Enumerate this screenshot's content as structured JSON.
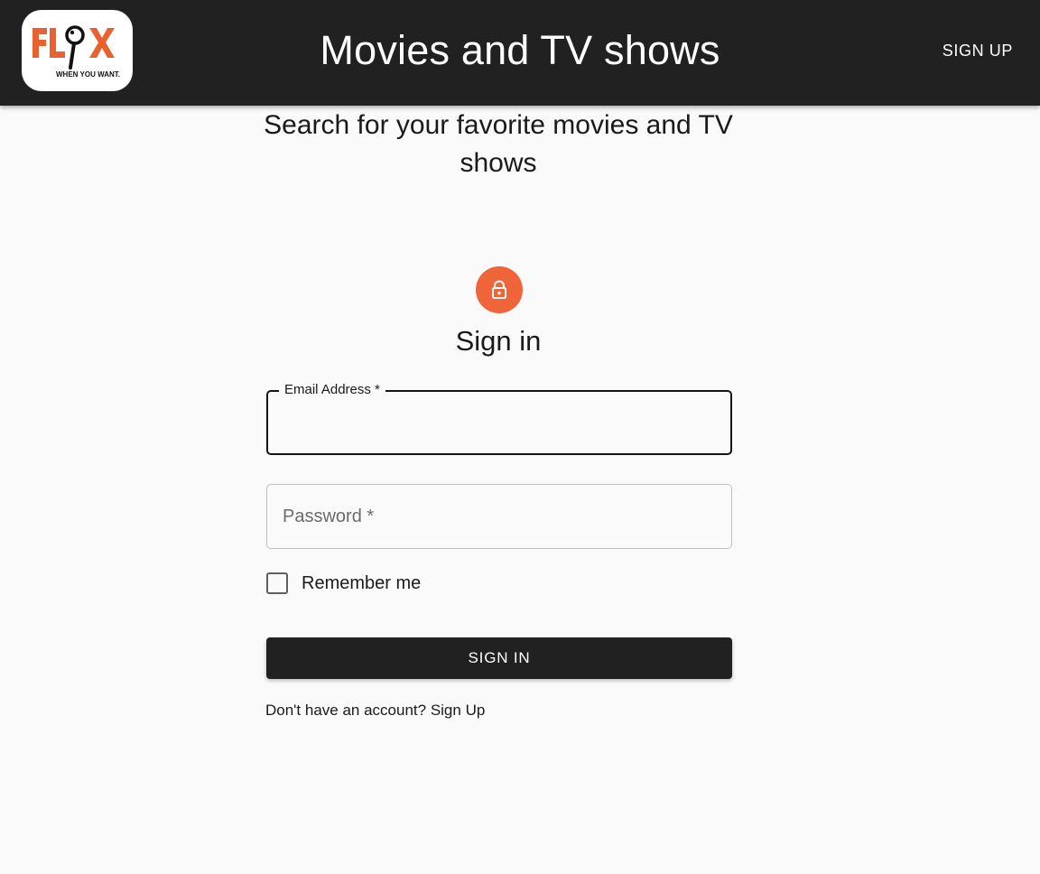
{
  "header": {
    "logo": {
      "text": "FLIX",
      "tagline": "WHEN YOU WANT.",
      "brand_color": "#e8622f"
    },
    "title": "Movies and TV shows",
    "signup_label": "SIGN UP",
    "background_color": "#212121"
  },
  "main": {
    "subtitle": "Search for your favorite movies and TV shows",
    "lock_icon": "lock-icon",
    "lock_color": "#f0643a",
    "heading": "Sign in",
    "email_field": {
      "label": "Email Address *",
      "value": ""
    },
    "password_field": {
      "label": "Password *",
      "value": ""
    },
    "remember_me": {
      "label": "Remember me",
      "checked": false
    },
    "submit_label": "SIGN IN",
    "signup_prompt": "Don't have an account? Sign Up"
  }
}
